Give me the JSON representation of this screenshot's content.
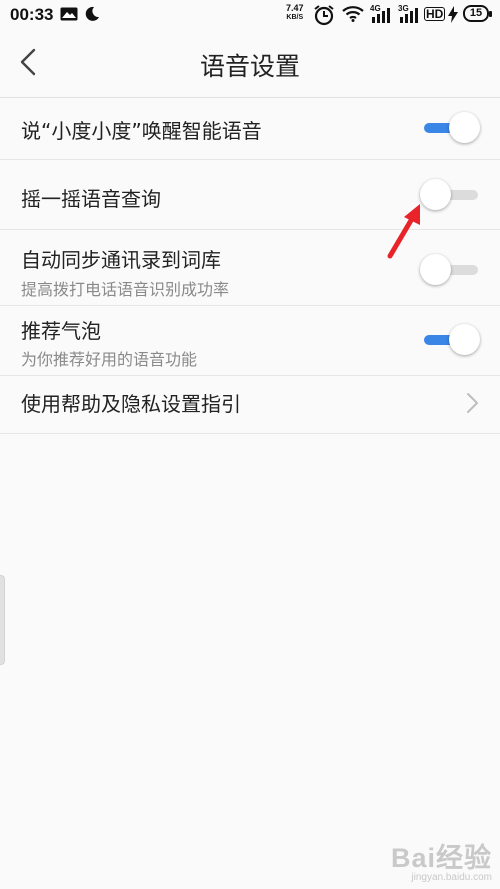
{
  "status_bar": {
    "time": "00:33",
    "net_speed": "7.47",
    "net_speed_unit": "KB/S",
    "signal1_label": "4G",
    "signal2_label": "3G",
    "hd_label": "HD",
    "battery_level": "15"
  },
  "header": {
    "title": "语音设置",
    "back_icon": "chevron-left-icon"
  },
  "settings": {
    "wake_word": {
      "label": "说“小度小度”唤醒智能语音",
      "enabled": true
    },
    "shake_query": {
      "label": "摇一摇语音查询",
      "enabled": false
    },
    "sync_contacts": {
      "label": "自动同步通讯录到词库",
      "description": "提高拨打电话语音识别成功率",
      "enabled": false
    },
    "bubble": {
      "label": "推荐气泡",
      "description": "为你推荐好用的语音功能",
      "enabled": true
    },
    "help_privacy": {
      "label": "使用帮助及隐私设置指引",
      "icon": "chevron-right-icon"
    }
  },
  "colors": {
    "accent": "#3a86e6",
    "toggle_off": "#dcdcdc",
    "annotation_arrow": "#e8242a"
  },
  "watermark": {
    "text": "Bai经验",
    "url": "jingyan.baidu.com"
  }
}
